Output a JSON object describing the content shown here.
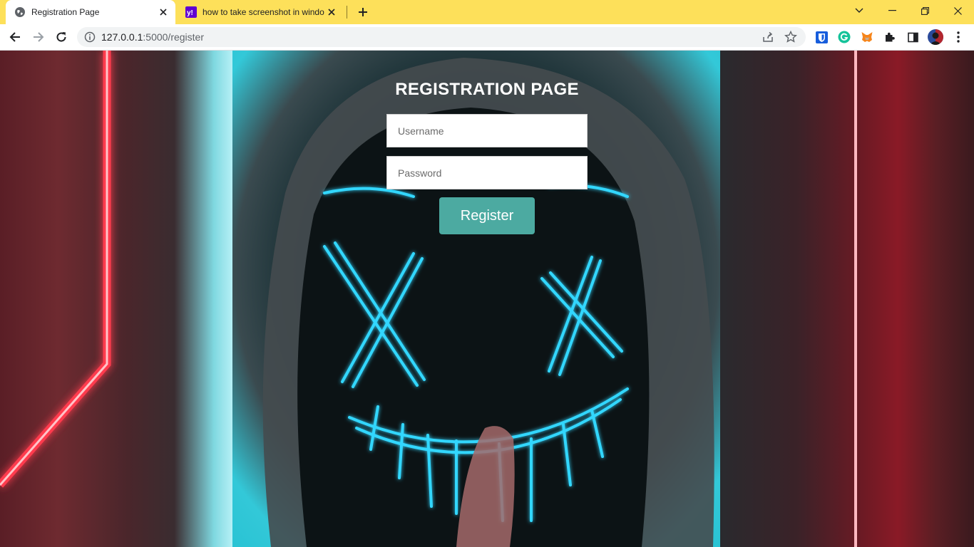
{
  "browser": {
    "tabs": [
      {
        "title": "Registration Page",
        "favicon": "globe-icon",
        "active": true
      },
      {
        "title": "how to take screenshot in windo",
        "favicon": "yahoo-icon",
        "active": false
      }
    ],
    "address_bar": {
      "host": "127.0.0.1",
      "path": ":5000/register"
    },
    "accent_color": "#fde05a"
  },
  "page": {
    "title": "REGISTRATION PAGE",
    "username_placeholder": "Username",
    "password_placeholder": "Password",
    "register_label": "Register",
    "button_color": "#4caaa1"
  }
}
